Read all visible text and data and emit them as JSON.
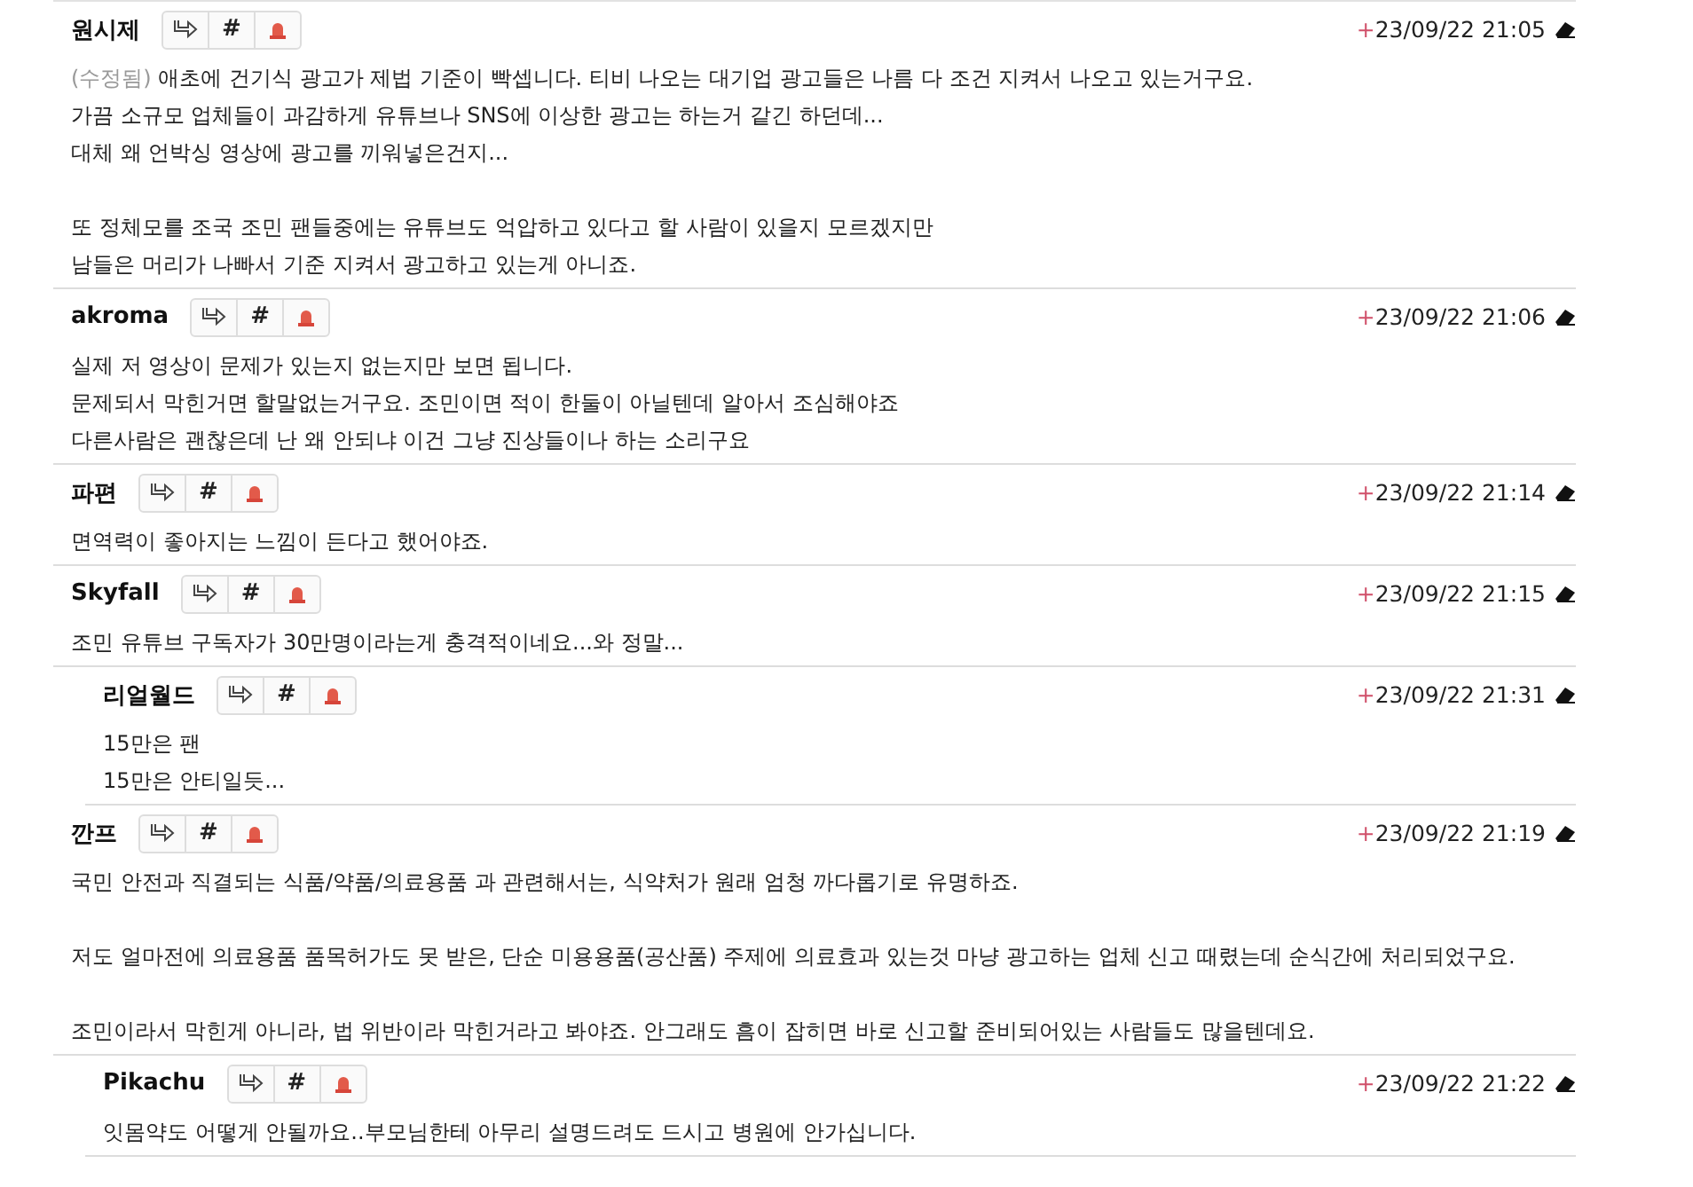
{
  "comments": [
    {
      "author": "원시제",
      "anchor_label": "#",
      "expand_mark": "+",
      "date": "23/09/22 21:05",
      "edited_label": "(수정됨)",
      "paragraphs": [
        [
          "애초에 건기식 광고가 제법 기준이 빡셉니다. 티비 나오는 대기업 광고들은 나름 다 조건 지켜서 나오고 있는거구요.",
          "가끔 소규모 업체들이 과감하게 유튜브나 SNS에 이상한 광고는 하는거 같긴 하던데...",
          "대체 왜 언박싱 영상에 광고를 끼워넣은건지..."
        ],
        [
          "또 정체모를 조국 조민 팬들중에는 유튜브도 억압하고 있다고 할 사람이 있을지 모르겠지만",
          "남들은 머리가 나빠서 기준 지켜서 광고하고 있는게 아니죠."
        ]
      ]
    },
    {
      "author": "akroma",
      "anchor_label": "#",
      "expand_mark": "+",
      "date": "23/09/22 21:06",
      "paragraphs": [
        [
          "실제 저 영상이 문제가 있는지 없는지만 보면 됩니다.",
          "문제되서 막힌거면 할말없는거구요. 조민이면 적이 한둘이 아닐텐데 알아서 조심해야죠",
          "다른사람은 괜찮은데 난 왜 안되냐 이건 그냥 진상들이나 하는 소리구요"
        ]
      ]
    },
    {
      "author": "파편",
      "anchor_label": "#",
      "expand_mark": "+",
      "date": "23/09/22 21:14",
      "paragraphs": [
        [
          "면역력이 좋아지는 느낌이 든다고 했어야죠."
        ]
      ]
    },
    {
      "author": "Skyfall",
      "anchor_label": "#",
      "expand_mark": "+",
      "date": "23/09/22 21:15",
      "paragraphs": [
        [
          "조민 유튜브 구독자가 30만명이라는게 충격적이네요...와 정말..."
        ]
      ],
      "children": [
        {
          "author": "리얼월드",
          "anchor_label": "#",
          "expand_mark": "+",
          "date": "23/09/22 21:31",
          "paragraphs": [
            [
              "15만은 팬",
              "15만은 안티일듯..."
            ]
          ]
        }
      ]
    },
    {
      "author": "깐프",
      "anchor_label": "#",
      "expand_mark": "+",
      "date": "23/09/22 21:19",
      "paragraphs": [
        [
          "국민 안전과 직결되는 식품/약품/의료용품 과 관련해서는, 식약처가 원래 엄청 까다롭기로 유명하죠."
        ],
        [
          "저도 얼마전에 의료용품 품목허가도 못 받은, 단순 미용용품(공산품) 주제에 의료효과 있는것 마냥 광고하는 업체 신고 때렸는데 순식간에 처리되었구요."
        ],
        [
          "조민이라서 막힌게 아니라, 법 위반이라 막힌거라고 봐야죠. 안그래도 흠이 잡히면 바로 신고할 준비되어있는 사람들도 많을텐데요."
        ]
      ],
      "children": [
        {
          "author": "Pikachu",
          "anchor_label": "#",
          "expand_mark": "+",
          "date": "23/09/22 21:22",
          "paragraphs": [
            [
              "잇몸약도 어떻게 안될까요..부모님한테 아무리 설명드려도 드시고 병원에 안가십니다."
            ]
          ]
        }
      ]
    }
  ]
}
